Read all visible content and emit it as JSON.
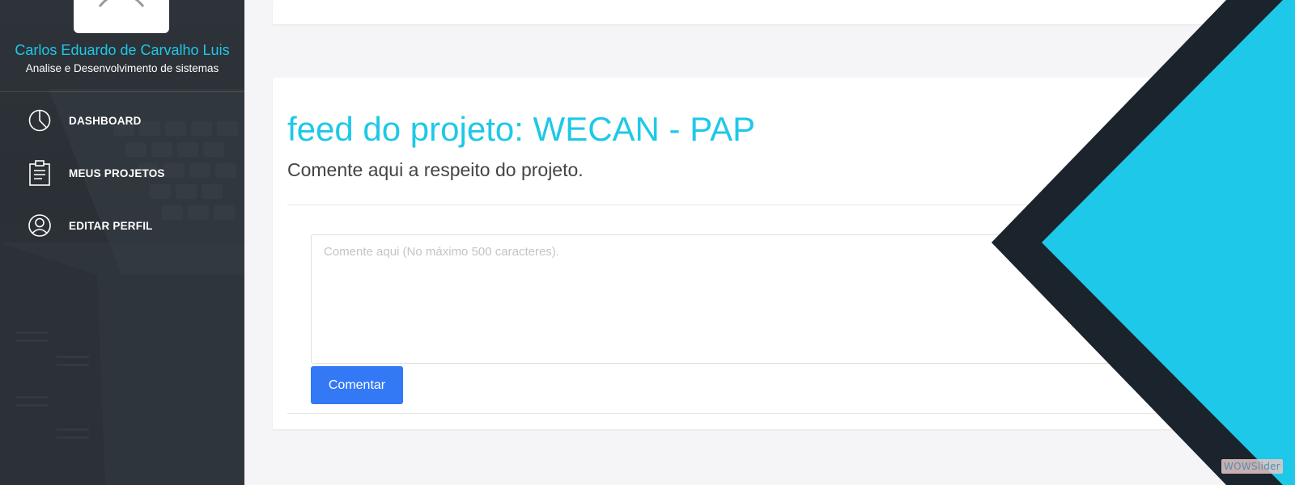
{
  "user": {
    "name": "Carlos Eduardo de Carvalho Luis",
    "role": "Analise e Desenvolvimento de sistemas"
  },
  "sidebar": {
    "items": [
      {
        "label": "DASHBOARD",
        "icon": "pie-chart-icon"
      },
      {
        "label": "MEUS PROJETOS",
        "icon": "clipboard-icon"
      },
      {
        "label": "EDITAR PERFIL",
        "icon": "user-circle-icon"
      }
    ]
  },
  "feed": {
    "title": "feed do projeto: WECAN - PAP",
    "subtitle": "Comente aqui a respeito do projeto.",
    "comment_placeholder": "Comente aqui (No máximo 500 caracteres).",
    "comment_value": "",
    "submit_label": "Comentar"
  },
  "watermark": "WOWSlider",
  "colors": {
    "accent": "#1ec8e8",
    "primary_button": "#3378f5",
    "sidebar_bg": "#2d3338",
    "chevron_dark": "#1b232c",
    "chevron_cyan": "#1ec8e8"
  }
}
